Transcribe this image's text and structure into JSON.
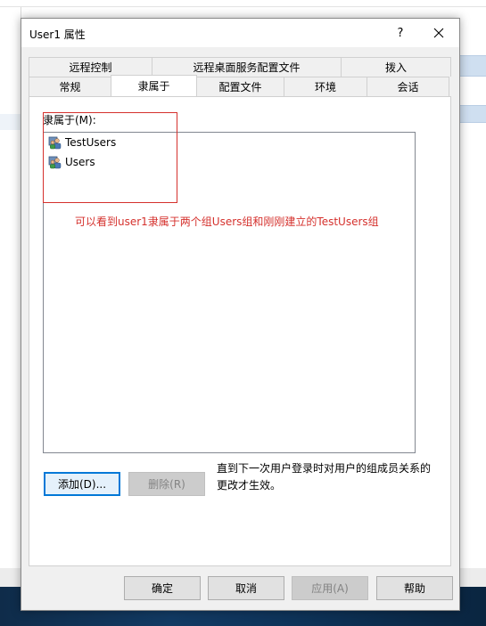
{
  "dialog": {
    "title": "User1 属性",
    "help_label": "?",
    "close_label": "关闭"
  },
  "tabs": {
    "row1": [
      {
        "label": "远程控制"
      },
      {
        "label": "远程桌面服务配置文件"
      },
      {
        "label": "拨入"
      }
    ],
    "row2": [
      {
        "label": "常规"
      },
      {
        "label": "隶属于"
      },
      {
        "label": "配置文件"
      },
      {
        "label": "环境"
      },
      {
        "label": "会话"
      }
    ],
    "active": "隶属于"
  },
  "membership": {
    "label": "隶属于(M):",
    "items": [
      {
        "name": "TestUsers",
        "icon": "group-icon"
      },
      {
        "name": "Users",
        "icon": "group-icon"
      }
    ]
  },
  "annotation": "可以看到user1隶属于两个组Users组和刚刚建立的TestUsers组",
  "panel_buttons": {
    "add_label": "添加(D)...",
    "remove_label": "删除(R)"
  },
  "notice": "直到下一次用户登录时对用户的组成员关系的更改才生效。",
  "footer": {
    "ok_label": "确定",
    "cancel_label": "取消",
    "apply_label": "应用(A)",
    "help_label": "帮助"
  },
  "colors": {
    "annotation_red": "#d5312d",
    "focus_blue": "#0078d7"
  }
}
